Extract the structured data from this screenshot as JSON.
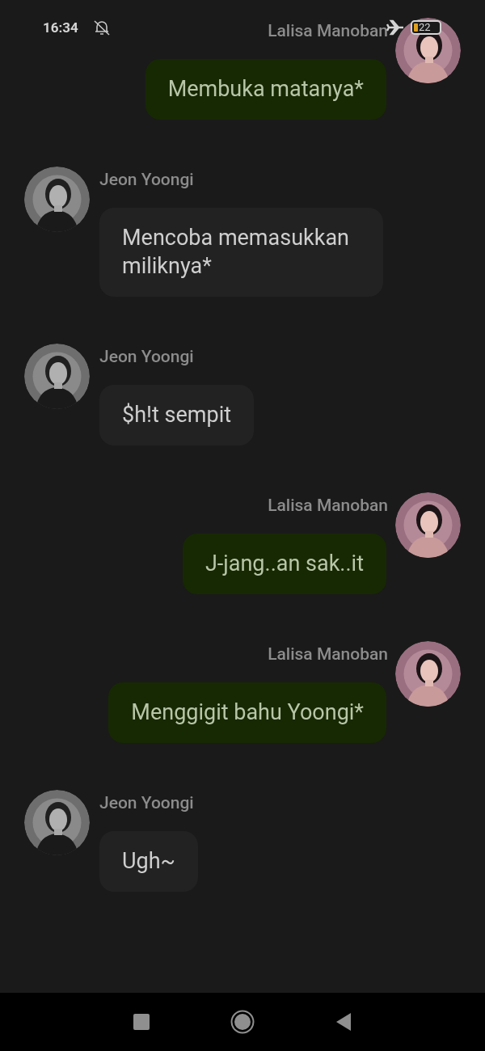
{
  "status_bar": {
    "time": "16:34",
    "battery": "22"
  },
  "messages": [
    {
      "kind": "sent",
      "sender": "Lalisa Manoban",
      "text": "Membuka matanya*"
    },
    {
      "kind": "received",
      "sender": "Jeon Yoongi",
      "text": "Mencoba memasukkan miliknya*"
    },
    {
      "kind": "received",
      "sender": "Jeon Yoongi",
      "text": "$h!t sempit"
    },
    {
      "kind": "sent",
      "sender": "Lalisa Manoban",
      "text": "J-jang..an sak..it"
    },
    {
      "kind": "sent",
      "sender": "Lalisa Manoban",
      "text": "Menggigit bahu Yoongi*"
    },
    {
      "kind": "received",
      "sender": "Jeon Yoongi",
      "text": "Ugh~"
    }
  ]
}
